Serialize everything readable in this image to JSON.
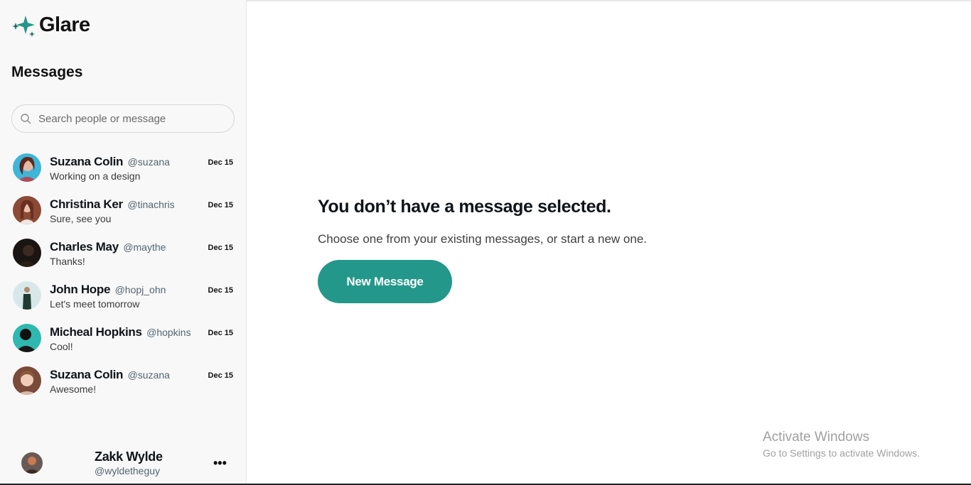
{
  "app": {
    "name": "Glare",
    "brand_color": "#23988a"
  },
  "sidebar": {
    "title": "Messages",
    "search": {
      "placeholder": "Search people or message",
      "value": ""
    },
    "conversations": [
      {
        "name": "Suzana Colin",
        "handle": "@suzana",
        "preview": "Working on a design",
        "date": "Dec 15"
      },
      {
        "name": "Christina Ker",
        "handle": "@tinachris",
        "preview": "Sure, see you",
        "date": "Dec 15"
      },
      {
        "name": "Charles May",
        "handle": "@maythe",
        "preview": "Thanks!",
        "date": "Dec 15"
      },
      {
        "name": "John Hope",
        "handle": "@hopj_ohn",
        "preview": "Let's meet tomorrow",
        "date": "Dec 15"
      },
      {
        "name": "Micheal Hopkins",
        "handle": "@hopkins",
        "preview": "Cool!",
        "date": "Dec 15"
      },
      {
        "name": "Suzana Colin",
        "handle": "@suzana",
        "preview": "Awesome!",
        "date": "Dec 15"
      }
    ],
    "current_user": {
      "name": "Zakk Wylde",
      "handle": "@wyldetheguy",
      "more_label": "•••"
    }
  },
  "main": {
    "empty_title": "You don’t have a message selected.",
    "empty_subtitle": "Choose one from your existing messages, or start a new one.",
    "new_message_label": "New Message"
  },
  "watermark": {
    "title": "Activate Windows",
    "subtitle": "Go to Settings to activate Windows."
  }
}
